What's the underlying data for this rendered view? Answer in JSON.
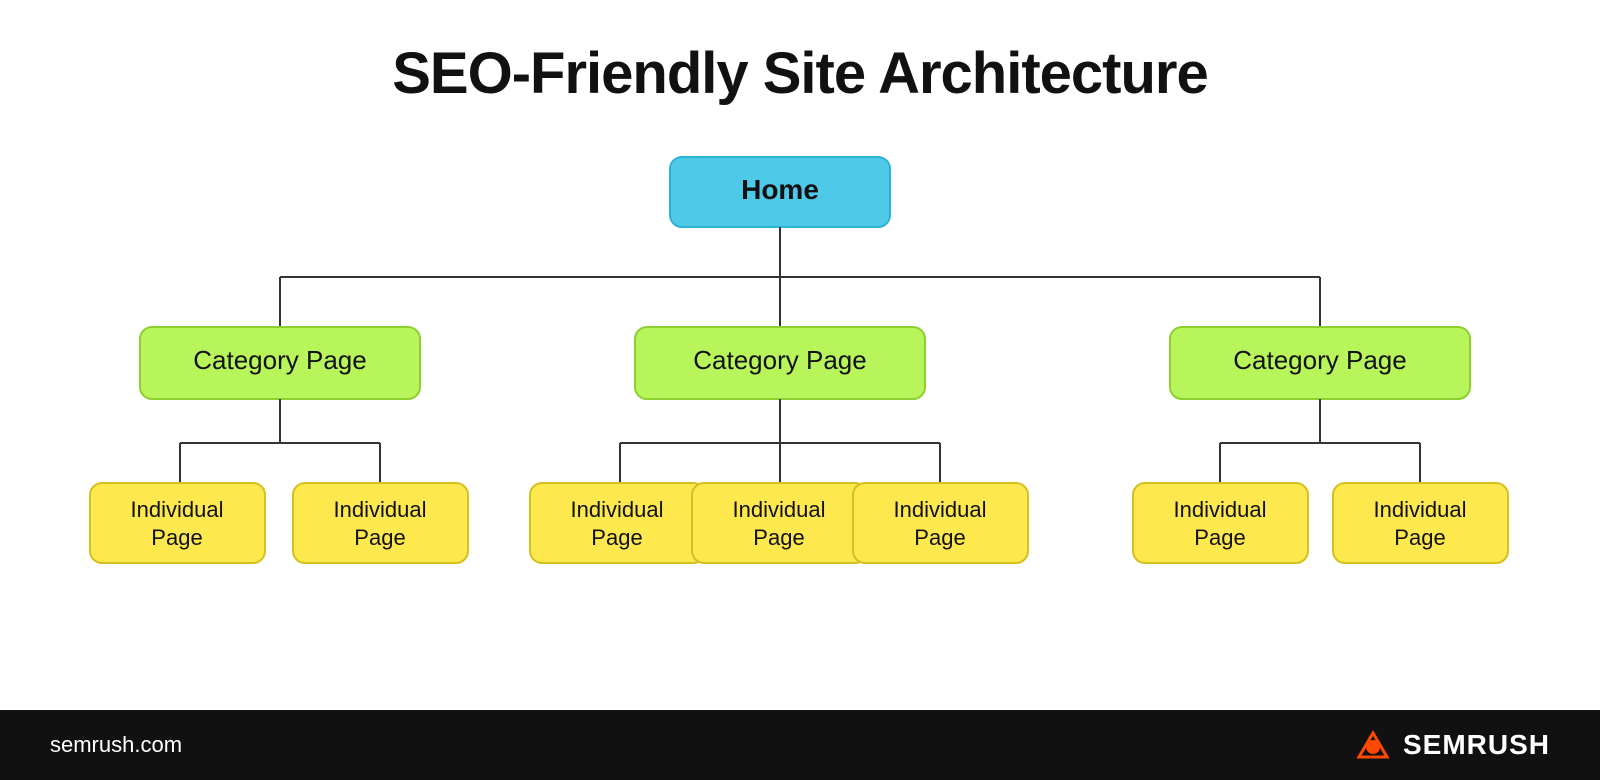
{
  "title": "SEO-Friendly Site Architecture",
  "diagram": {
    "home": {
      "label": "Home"
    },
    "categories": [
      {
        "label": "Category Page"
      },
      {
        "label": "Category Page"
      },
      {
        "label": "Category Page"
      }
    ],
    "individual_groups": [
      [
        {
          "label": "Individual\nPage"
        },
        {
          "label": "Individual\nPage"
        }
      ],
      [
        {
          "label": "Individual\nPage"
        },
        {
          "label": "Individual\nPage"
        },
        {
          "label": "Individual\nPage"
        }
      ],
      [
        {
          "label": "Individual\nPage"
        },
        {
          "label": "Individual\nPage"
        }
      ]
    ]
  },
  "footer": {
    "url": "semrush.com",
    "brand": "SEMRUSH"
  },
  "colors": {
    "home_bg": "#4ec9e8",
    "home_border": "#2ab5d8",
    "category_bg": "#b8f55a",
    "category_border": "#8ecf30",
    "individual_bg": "#fde84e",
    "individual_border": "#d4c020",
    "connector": "#333333",
    "footer_bg": "#111111",
    "footer_text": "#ffffff",
    "semrush_orange": "#ff4800"
  }
}
